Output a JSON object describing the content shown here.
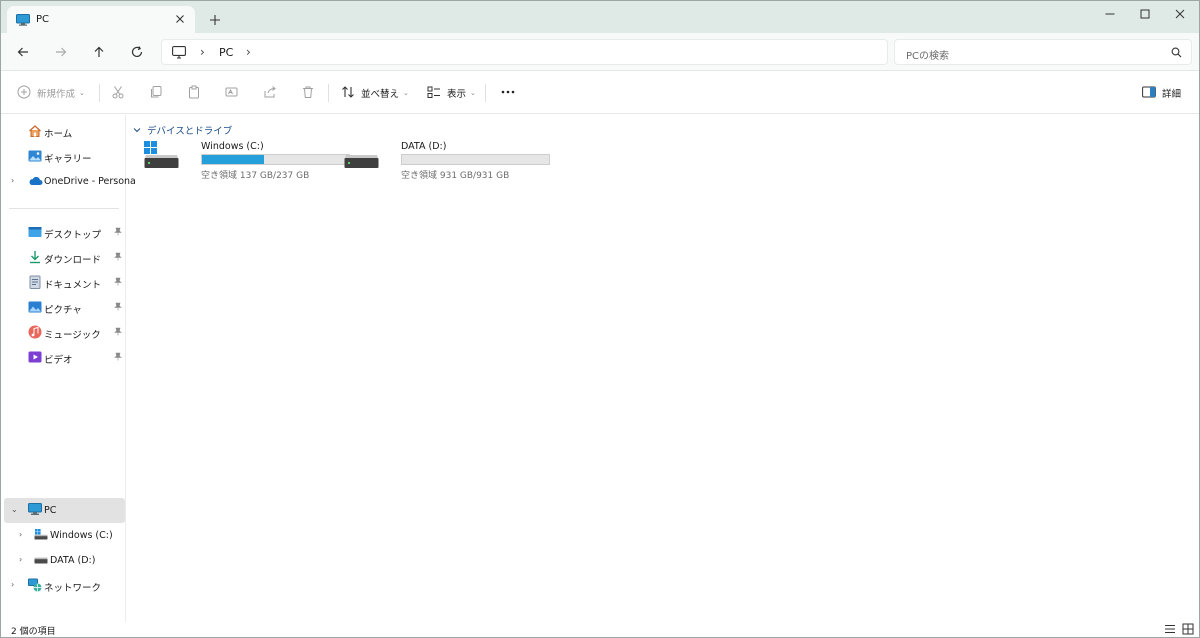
{
  "window": {
    "tab_title": "PC",
    "tab_icon": "monitor-icon",
    "accent_color": "#26a0da",
    "titlebar_color": "#dfe9e5"
  },
  "navigation": {
    "breadcrumb_item": "PC",
    "search_placeholder": "PCの検索"
  },
  "toolbar": {
    "new_label": "新規作成",
    "sort_label": "並べ替え",
    "view_label": "表示",
    "details_label": "詳細"
  },
  "sidebar": {
    "home": "ホーム",
    "gallery": "ギャラリー",
    "onedrive": "OneDrive - Persona",
    "pinned": [
      {
        "label": "デスクトップ",
        "icon": "desktop-folder-icon"
      },
      {
        "label": "ダウンロード",
        "icon": "download-folder-icon"
      },
      {
        "label": "ドキュメント",
        "icon": "documents-folder-icon"
      },
      {
        "label": "ピクチャ",
        "icon": "pictures-folder-icon"
      },
      {
        "label": "ミュージック",
        "icon": "music-folder-icon"
      },
      {
        "label": "ビデオ",
        "icon": "videos-folder-icon"
      }
    ],
    "pc": "PC",
    "drive_c": "Windows (C:)",
    "drive_d": "DATA (D:)",
    "network": "ネットワーク"
  },
  "content": {
    "group_header": "デバイスとドライブ",
    "drives": [
      {
        "name": "Windows (C:)",
        "free_text": "空き領域 137 GB/237 GB",
        "used_fraction": 0.422
      },
      {
        "name": "DATA (D:)",
        "free_text": "空き領域 931 GB/931 GB",
        "used_fraction": 0.0
      }
    ]
  },
  "status": {
    "item_count": "2 個の項目"
  }
}
